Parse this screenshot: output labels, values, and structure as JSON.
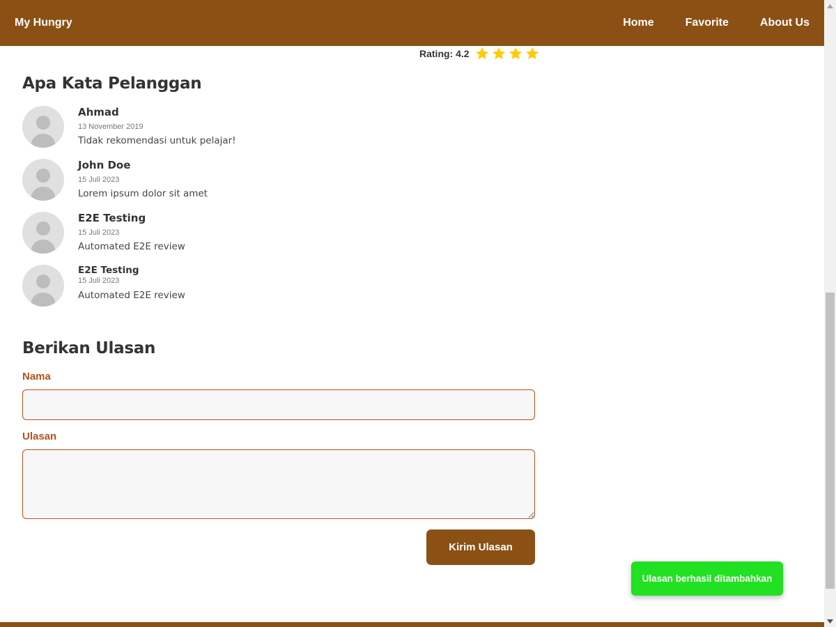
{
  "navbar": {
    "brand": "My Hungry",
    "links": [
      "Home",
      "Favorite",
      "About Us"
    ],
    "background": "#8b5014"
  },
  "rating": {
    "label": "Rating: 4.2",
    "value": 4.2,
    "stars_shown": 4,
    "star_color": "#ffcc00"
  },
  "reviews_section": {
    "title": "Apa Kata Pelanggan",
    "reviews": [
      {
        "name": "Ahmad",
        "date": "13 November 2019",
        "text": "Tidak rekomendasi untuk pelajar!"
      },
      {
        "name": "John Doe",
        "date": "15 Juli 2023",
        "text": "Lorem ipsum dolor sit amet"
      },
      {
        "name": "E2E Testing",
        "date": "15 Juli 2023",
        "text": "Automated E2E review"
      },
      {
        "name": "E2E Testing",
        "date": "15 Juli 2023",
        "text": "Automated E2E review"
      }
    ]
  },
  "form": {
    "title": "Berikan Ulasan",
    "name_label": "Nama",
    "name_value": "",
    "review_label": "Ulasan",
    "review_value": "",
    "submit_label": "Kirim Ulasan",
    "accent": "#b5521b"
  },
  "toast": {
    "message": "Ulasan berhasil ditambahkan",
    "color": "#22e022"
  }
}
